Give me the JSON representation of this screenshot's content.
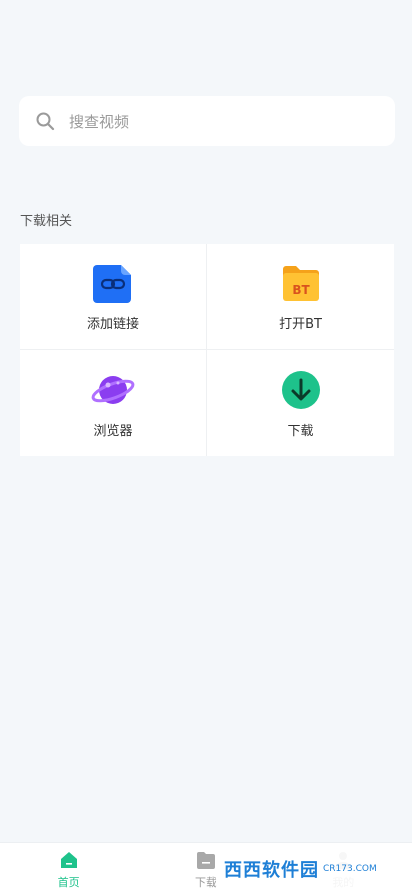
{
  "search": {
    "placeholder": "搜查视频"
  },
  "section": {
    "title": "下载相关"
  },
  "tiles": [
    {
      "label": "添加链接",
      "icon": "link-file-icon"
    },
    {
      "label": "打开BT",
      "icon": "bt-folder-icon"
    },
    {
      "label": "浏览器",
      "icon": "planet-icon"
    },
    {
      "label": "下载",
      "icon": "download-icon"
    }
  ],
  "nav": [
    {
      "label": "首页",
      "icon": "home-icon"
    },
    {
      "label": "下载",
      "icon": "folder-icon"
    },
    {
      "label": "我的",
      "icon": "user-icon"
    }
  ],
  "watermark": {
    "text": "西西软件园",
    "sub": "CR173.COM"
  },
  "colors": {
    "accent": "#1ec28b",
    "background": "#f4f7fa"
  }
}
